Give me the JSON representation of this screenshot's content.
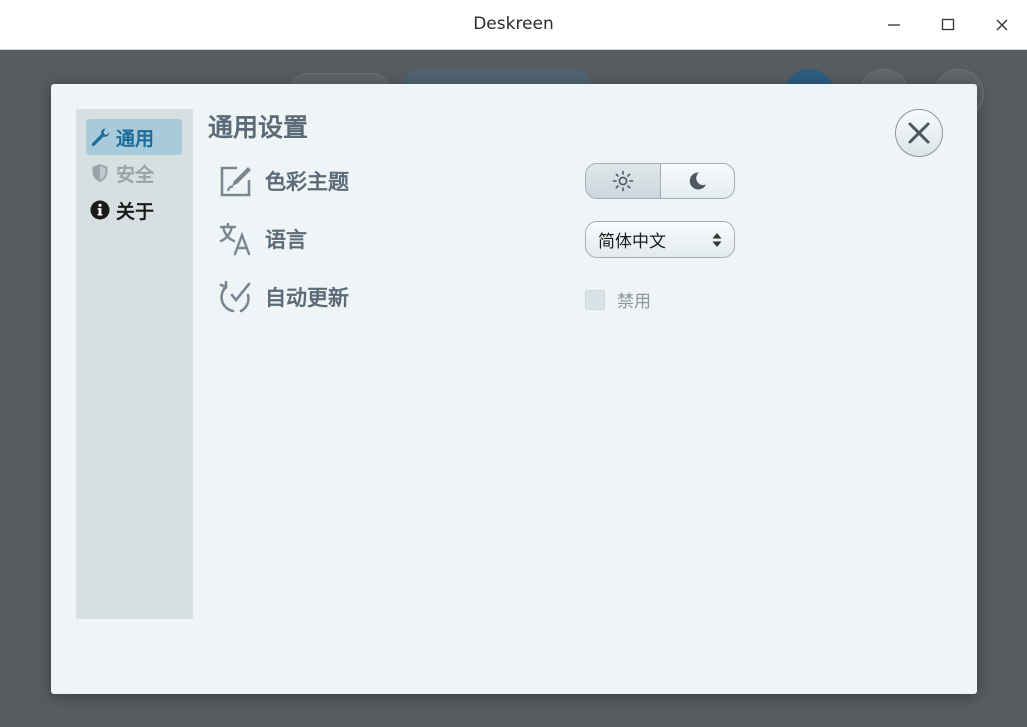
{
  "window": {
    "title": "Deskreen",
    "controls": [
      "minimize",
      "maximize",
      "close"
    ]
  },
  "settings": {
    "panel_title": "通用设置",
    "sidebar": [
      {
        "label": "通用",
        "icon": "wrench-icon",
        "state": "active"
      },
      {
        "label": "安全",
        "icon": "shield-icon",
        "state": "disabled"
      },
      {
        "label": "关于",
        "icon": "info-icon",
        "state": "normal"
      }
    ],
    "rows": {
      "theme": {
        "label": "色彩主题",
        "icon": "edit-icon",
        "options": [
          "light",
          "dark"
        ],
        "selected": "light"
      },
      "language": {
        "label": "语言",
        "icon": "translate-icon",
        "value": "简体中文"
      },
      "auto_update": {
        "label": "自动更新",
        "icon": "refresh-check-icon",
        "checkbox_label": "禁用",
        "checked": false,
        "enabled": false
      }
    }
  },
  "colors": {
    "accent": "#1c6c9a",
    "overlay": "#575c61",
    "dialog_bg": "#eff5f7",
    "sidebar_bg": "#d8dfe1"
  }
}
